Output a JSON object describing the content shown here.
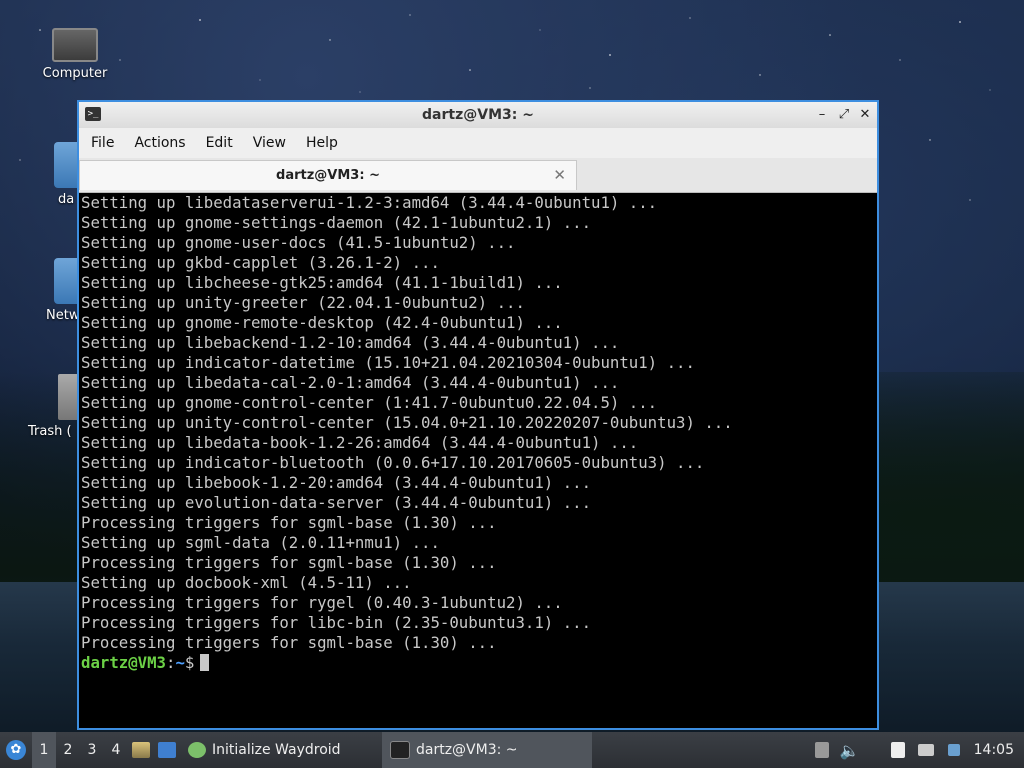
{
  "desktop": {
    "icons": [
      {
        "label": "Computer"
      },
      {
        "label": "da"
      },
      {
        "label": "Netw"
      },
      {
        "label": "Trash ("
      }
    ]
  },
  "window": {
    "title": "dartz@VM3: ~",
    "menu": [
      "File",
      "Actions",
      "Edit",
      "View",
      "Help"
    ],
    "tab_label": "dartz@VM3: ~",
    "lines": [
      "Setting up libedataserverui-1.2-3:amd64 (3.44.4-0ubuntu1) ...",
      "Setting up gnome-settings-daemon (42.1-1ubuntu2.1) ...",
      "Setting up gnome-user-docs (41.5-1ubuntu2) ...",
      "Setting up gkbd-capplet (3.26.1-2) ...",
      "Setting up libcheese-gtk25:amd64 (41.1-1build1) ...",
      "Setting up unity-greeter (22.04.1-0ubuntu2) ...",
      "Setting up gnome-remote-desktop (42.4-0ubuntu1) ...",
      "Setting up libebackend-1.2-10:amd64 (3.44.4-0ubuntu1) ...",
      "Setting up indicator-datetime (15.10+21.04.20210304-0ubuntu1) ...",
      "Setting up libedata-cal-2.0-1:amd64 (3.44.4-0ubuntu1) ...",
      "Setting up gnome-control-center (1:41.7-0ubuntu0.22.04.5) ...",
      "Setting up unity-control-center (15.04.0+21.10.20220207-0ubuntu3) ...",
      "Setting up libedata-book-1.2-26:amd64 (3.44.4-0ubuntu1) ...",
      "Setting up indicator-bluetooth (0.0.6+17.10.20170605-0ubuntu3) ...",
      "Setting up libebook-1.2-20:amd64 (3.44.4-0ubuntu1) ...",
      "Setting up evolution-data-server (3.44.4-0ubuntu1) ...",
      "Processing triggers for sgml-base (1.30) ...",
      "Setting up sgml-data (2.0.11+nmu1) ...",
      "Processing triggers for sgml-base (1.30) ...",
      "Setting up docbook-xml (4.5-11) ...",
      "Processing triggers for rygel (0.40.3-1ubuntu2) ...",
      "Processing triggers for libc-bin (2.35-0ubuntu3.1) ...",
      "Processing triggers for sgml-base (1.30) ..."
    ],
    "prompt": {
      "user": "dartz@VM3",
      "sep": ":",
      "path": "~",
      "symbol": "$"
    }
  },
  "taskbar": {
    "workspaces": [
      "1",
      "2",
      "3",
      "4"
    ],
    "tasks": [
      {
        "label": "Initialize Waydroid",
        "icon": "waydroid-icon"
      },
      {
        "label": "dartz@VM3: ~",
        "icon": "terminal-icon"
      }
    ],
    "clock": "14:05"
  }
}
